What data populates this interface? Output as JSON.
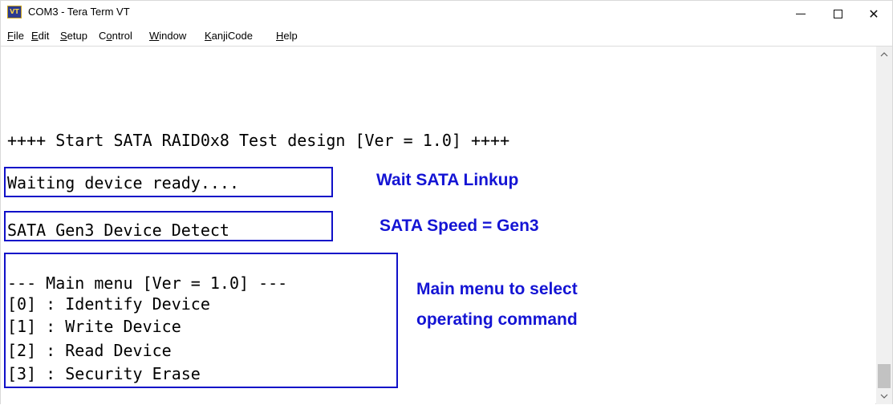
{
  "window": {
    "icon_text": "VT",
    "title": "COM3 - Tera Term VT",
    "controls": {
      "minimize": "minimize",
      "maximize": "maximize",
      "close": "✕"
    }
  },
  "menubar": {
    "items": [
      {
        "mnemonic": "F",
        "rest": "ile"
      },
      {
        "mnemonic": "E",
        "rest": "dit"
      },
      {
        "mnemonic": "S",
        "rest": "etup"
      },
      {
        "pre": "C",
        "mnemonic": "o",
        "rest": "ntrol"
      },
      {
        "mnemonic": "W",
        "rest": "indow"
      },
      {
        "mnemonic": "K",
        "rest": "anjiCode"
      },
      {
        "mnemonic": "H",
        "rest": "elp"
      }
    ]
  },
  "terminal": {
    "lines": [
      "++++ Start SATA RAID0x8 Test design [Ver = 1.0] ++++",
      "Waiting device ready....",
      "SATA Gen3 Device Detect",
      "--- Main menu [Ver = 1.0] ---",
      "[0] : Identify Device",
      "[1] : Write Device",
      "[2] : Read Device",
      "[3] : Security Erase"
    ]
  },
  "annotations": {
    "linkup": "Wait SATA Linkup",
    "speed": "SATA Speed = Gen3",
    "menu_line1": "Main menu to select",
    "menu_line2": "operating command"
  },
  "colors": {
    "annotation_blue": "#1414d4",
    "box_border": "#1010c8",
    "terminal_bg": "#ffffff",
    "terminal_fg": "#000000"
  }
}
